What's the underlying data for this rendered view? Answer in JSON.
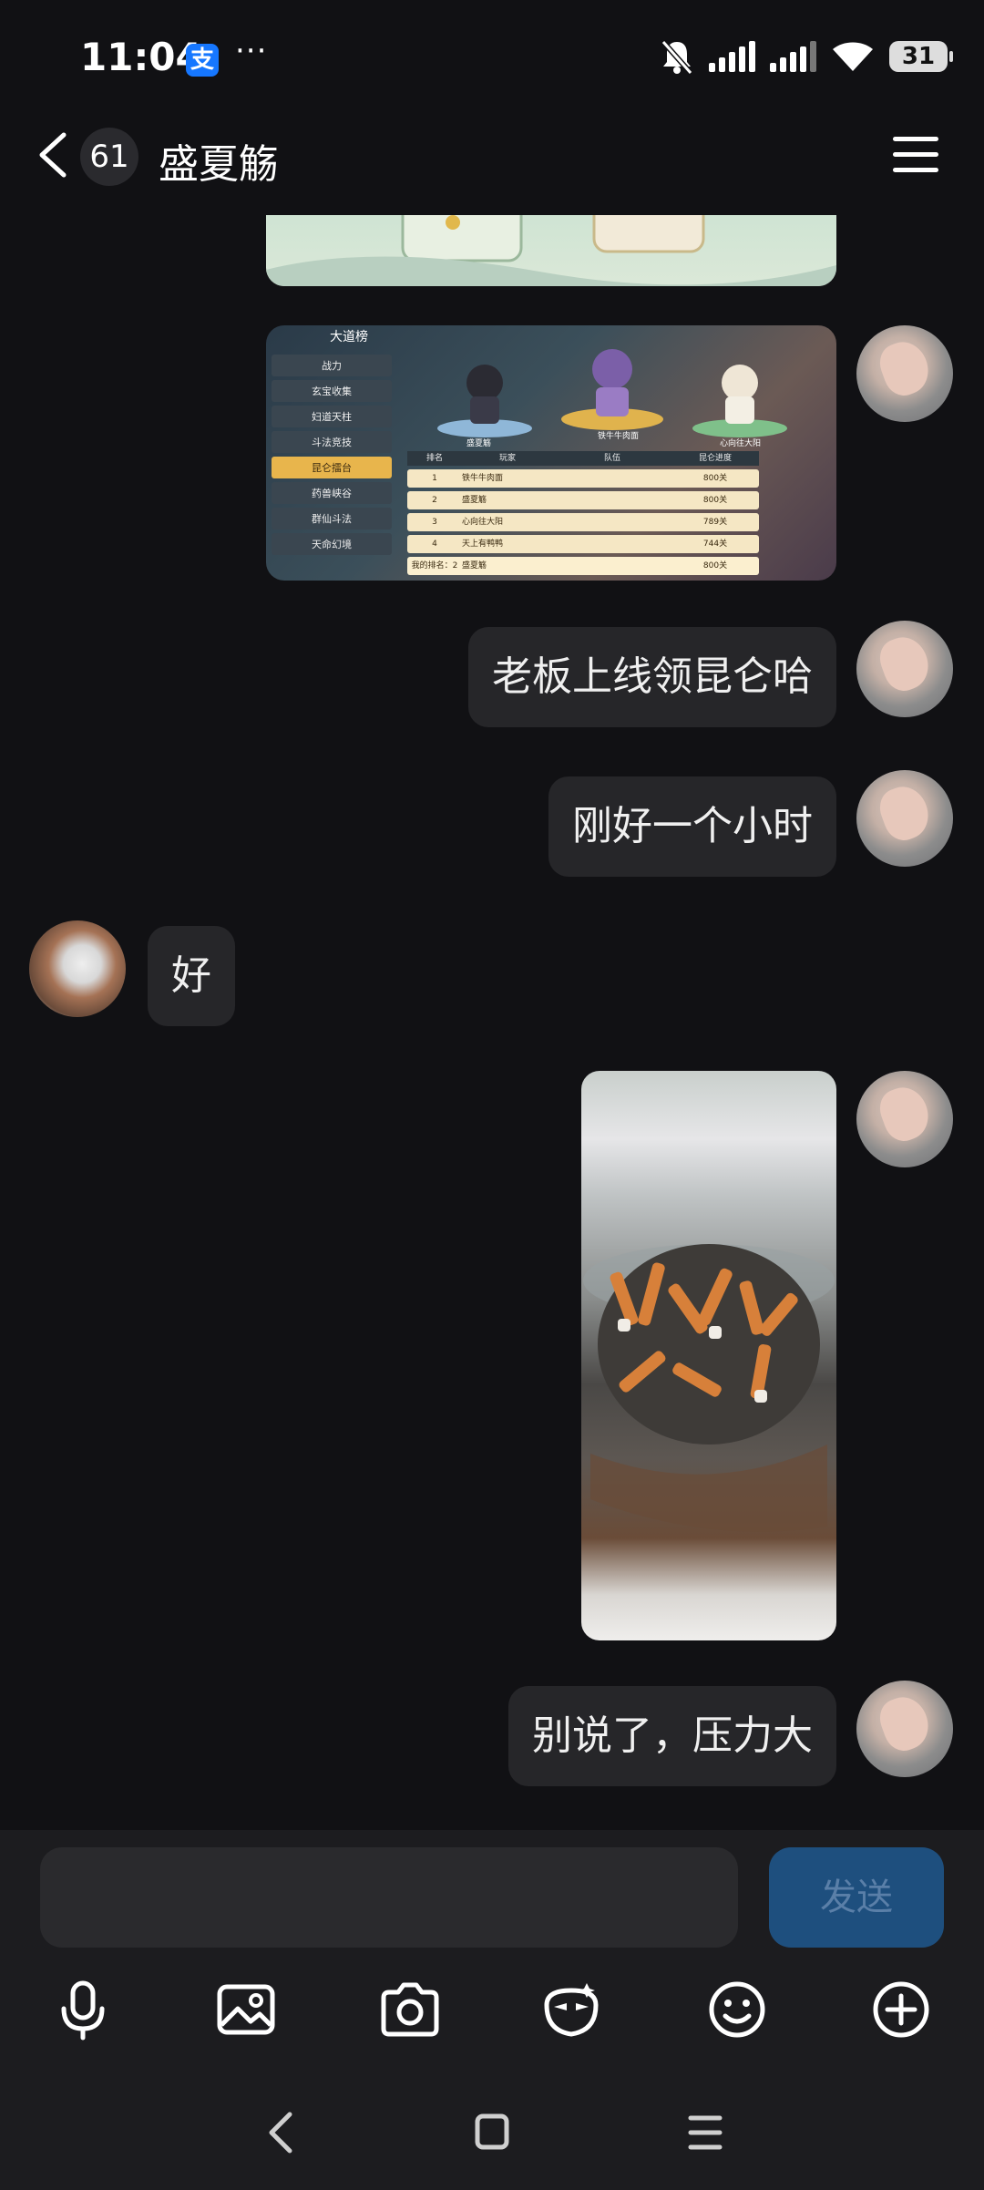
{
  "status_bar": {
    "time": "11:04",
    "alipay_badge": "支",
    "more_dots": "···",
    "battery": "31"
  },
  "header": {
    "unread_count": "61",
    "title": "盛夏觞"
  },
  "messages": [
    {
      "side": "right",
      "type": "image",
      "desc_icon": "image-thumb"
    },
    {
      "side": "right",
      "type": "image",
      "desc_icon": "game-ranking-image"
    },
    {
      "side": "right",
      "type": "text",
      "text": "老板上线领昆仑哈"
    },
    {
      "side": "right",
      "type": "text",
      "text": "刚好一个小时"
    },
    {
      "side": "left",
      "type": "text",
      "text": "好"
    },
    {
      "side": "right",
      "type": "image",
      "desc_icon": "ashtray-photo"
    },
    {
      "side": "right",
      "type": "text",
      "text": "别说了，压力大"
    }
  ],
  "game_image": {
    "title": "大道榜",
    "menu": [
      "战力",
      "玄宝收集",
      "妇道天柱",
      "斗法竞技",
      "昆仑擂台",
      "药兽峡谷",
      "群仙斗法",
      "天命幻境"
    ],
    "columns": [
      "排名",
      "玩家",
      "队伍",
      "昆仑进度"
    ],
    "rows": [
      {
        "rank": "1",
        "player": "铁牛牛肉面",
        "progress": "800关"
      },
      {
        "rank": "2",
        "player": "盛夏觞",
        "progress": "800关"
      },
      {
        "rank": "3",
        "player": "心向往大阳",
        "progress": "789关"
      },
      {
        "rank": "4",
        "player": "天上有鸭鸭",
        "progress": "744关"
      },
      {
        "rank": "我的排名：2",
        "player": "盛夏觞",
        "progress": "800关"
      }
    ],
    "podium": [
      "盛夏觞",
      "铁牛牛肉面",
      "心向往大阳"
    ]
  },
  "composer": {
    "send_label": "发送"
  },
  "colors": {
    "background": "#111114",
    "bubble": "#262629",
    "send_button": "#1e4f7e"
  }
}
